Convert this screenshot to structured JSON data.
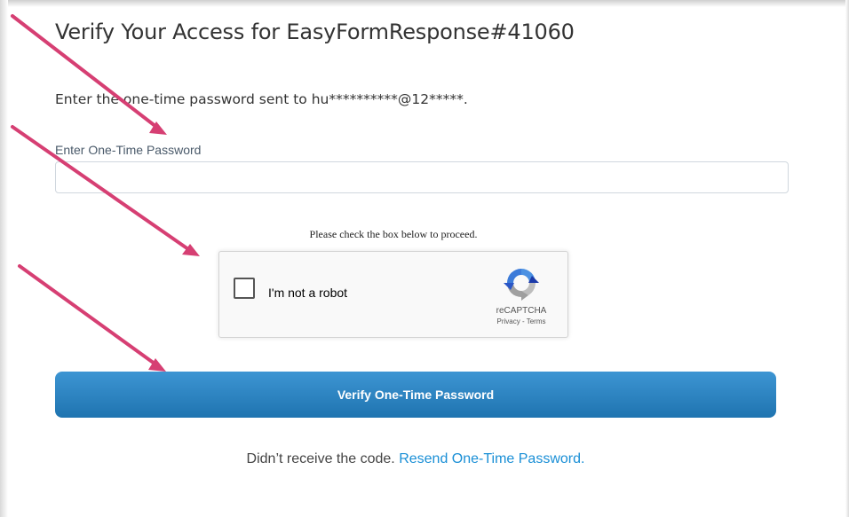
{
  "page": {
    "title": "Verify Your Access for EasyFormResponse#41060",
    "instruction": "Enter the one-time password sent to hu**********@12*****."
  },
  "otp": {
    "label": "Enter One-Time Password",
    "value": "",
    "placeholder": ""
  },
  "captcha": {
    "prompt": "Please check the box below to proceed.",
    "checkbox_label": "I'm not a robot",
    "checked": false,
    "brand": "reCAPTCHA",
    "privacy_link": "Privacy",
    "separator": " - ",
    "terms_link": "Terms",
    "logo_icon": "recaptcha-logo-icon"
  },
  "actions": {
    "verify_label": "Verify One-Time Password"
  },
  "resend": {
    "prefix": "Didn’t receive the code.",
    "link_label": "Resend One-Time Password."
  },
  "annotations": {
    "arrow_color": "#d63f73",
    "arrow_count": 4
  },
  "colors": {
    "button_top": "#3d95d3",
    "button_bottom": "#1f74b0",
    "link": "#1a8fd6",
    "title": "#333333"
  }
}
